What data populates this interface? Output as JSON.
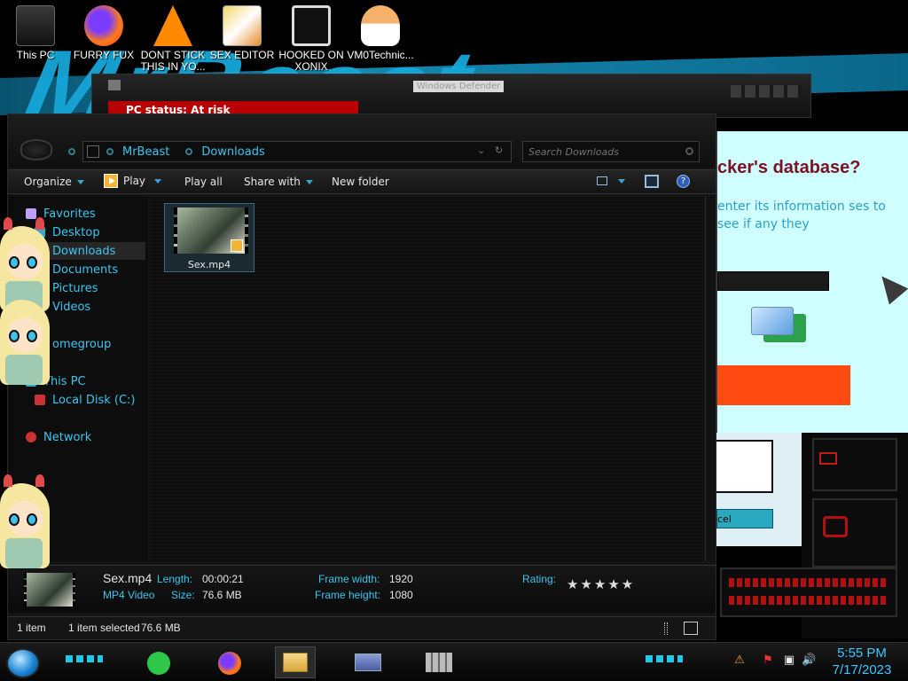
{
  "desktop_icons": [
    {
      "label": "This PC"
    },
    {
      "label": "FURRY FUX"
    },
    {
      "label": "DONT STICK THIS IN YO..."
    },
    {
      "label": "SEX EDITOR"
    },
    {
      "label": "HOOKED ON XONIX"
    },
    {
      "label": "VM0Technic..."
    }
  ],
  "defender": {
    "title": "Windows Defender",
    "status": "PC status: At risk"
  },
  "breach_dialog": {
    "heading": "cker's database?",
    "description": "enter its information ses to see if any they",
    "cancel_label": "cel"
  },
  "explorer": {
    "breadcrumb": [
      "MrBeast",
      "Downloads"
    ],
    "search_placeholder": "Search Downloads",
    "commands": {
      "organize": "Organize",
      "play": "Play",
      "play_all": "Play all",
      "share_with": "Share with",
      "new_folder": "New folder"
    },
    "nav": {
      "favorites": "Favorites",
      "desktop": "Desktop",
      "downloads": "Downloads",
      "documents": "Documents",
      "pictures": "Pictures",
      "videos": "Videos",
      "homegroup": "omegroup",
      "this_pc": "This PC",
      "local_disk": "Local Disk (C:)",
      "network": "Network"
    },
    "file": {
      "name": "Sex.mp4"
    },
    "details": {
      "name": "Sex.mp4",
      "type": "MP4 Video",
      "length_label": "Length:",
      "length": "00:00:21",
      "size_label": "Size:",
      "size": "76.6 MB",
      "frame_width_label": "Frame width:",
      "frame_width": "1920",
      "frame_height_label": "Frame height:",
      "frame_height": "1080",
      "rating_label": "Rating:",
      "rating_stars": "★★★★★"
    },
    "status": {
      "count": "1 item",
      "selected": "1 item selected",
      "selected_size": "76.6 MB"
    }
  },
  "taskbar": {
    "time": "5:55 PM",
    "date": "7/17/2023"
  },
  "colors": {
    "accent": "#39c6f0",
    "alert": "#b80000",
    "orange": "#ff4b12"
  }
}
